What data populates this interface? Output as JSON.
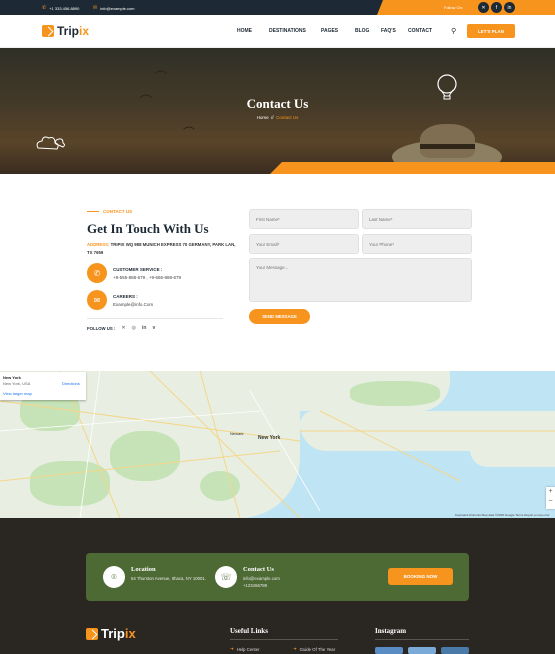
{
  "topbar": {
    "phone": "+1 333.456.8890",
    "email": "info@example.com",
    "follow_label": "Follow On:",
    "socials": [
      "x-icon",
      "facebook-icon",
      "linkedin-icon"
    ]
  },
  "nav": {
    "brand_1": "Trip",
    "brand_2": "ix",
    "items": [
      "HOME",
      "DESTINATIONS",
      "PAGES",
      "BLOG",
      "FAQ'S",
      "CONTACT"
    ],
    "cta": "LET'S PLAN"
  },
  "hero": {
    "title": "Contact Us",
    "crumb_home": "Home",
    "crumb_sep": "//",
    "crumb_current": "Contact Us"
  },
  "contact": {
    "eyebrow": "CONTACT US",
    "title": "Get In Touch With Us",
    "address_label": "ADDRESS:",
    "address_value": "TRIPIX WQ 988 MUNICH EXPRESS 70 GERMANY, PARK LAN, TX 7659",
    "support_label": "CUSTOMER SERVICE :",
    "support_value": "+9-555-888-679 , +9-666-888-679",
    "careers_label": "CAREERS :",
    "careers_value": "Example@info.Com",
    "follow_label": "FOLLOW US :",
    "follow_icons": [
      "x-icon",
      "instagram-icon",
      "linkedin-icon",
      "vimeo-icon"
    ]
  },
  "form": {
    "first_name": "First Name*",
    "last_name": "Last Name*",
    "email": "Your Email*",
    "phone": "Your Phone*",
    "message": "Your Message...",
    "submit": "SEND MESSAGE"
  },
  "map": {
    "place_name": "New York",
    "place_sub": "New York, USA",
    "larger_map": "View larger map",
    "directions": "Directions",
    "city_label": "New York",
    "newark": "Newark",
    "zoom_in": "+",
    "zoom_out": "−",
    "attribution": "Keyboard shortcuts   Map data ©2025 Google   Terms   Report a map error"
  },
  "footer": {
    "location_title": "Location",
    "location_value": "54 Thurston Avenue, Ithaca, NY 10001.",
    "contact_title": "Contact Us",
    "contact_email": "info@example.com",
    "contact_phone": "+123456789",
    "book": "BOOKING NOW",
    "brand_1": "Trip",
    "brand_2": "ix",
    "useful_links": "Useful Links",
    "links": [
      "Help Center",
      "Guide Of The Year"
    ],
    "instagram": "Instagram"
  },
  "colors": {
    "accent": "#f7941d",
    "navy": "#1d2a35",
    "footer_bg": "#2a2622",
    "footer_box": "#4e6a34"
  }
}
